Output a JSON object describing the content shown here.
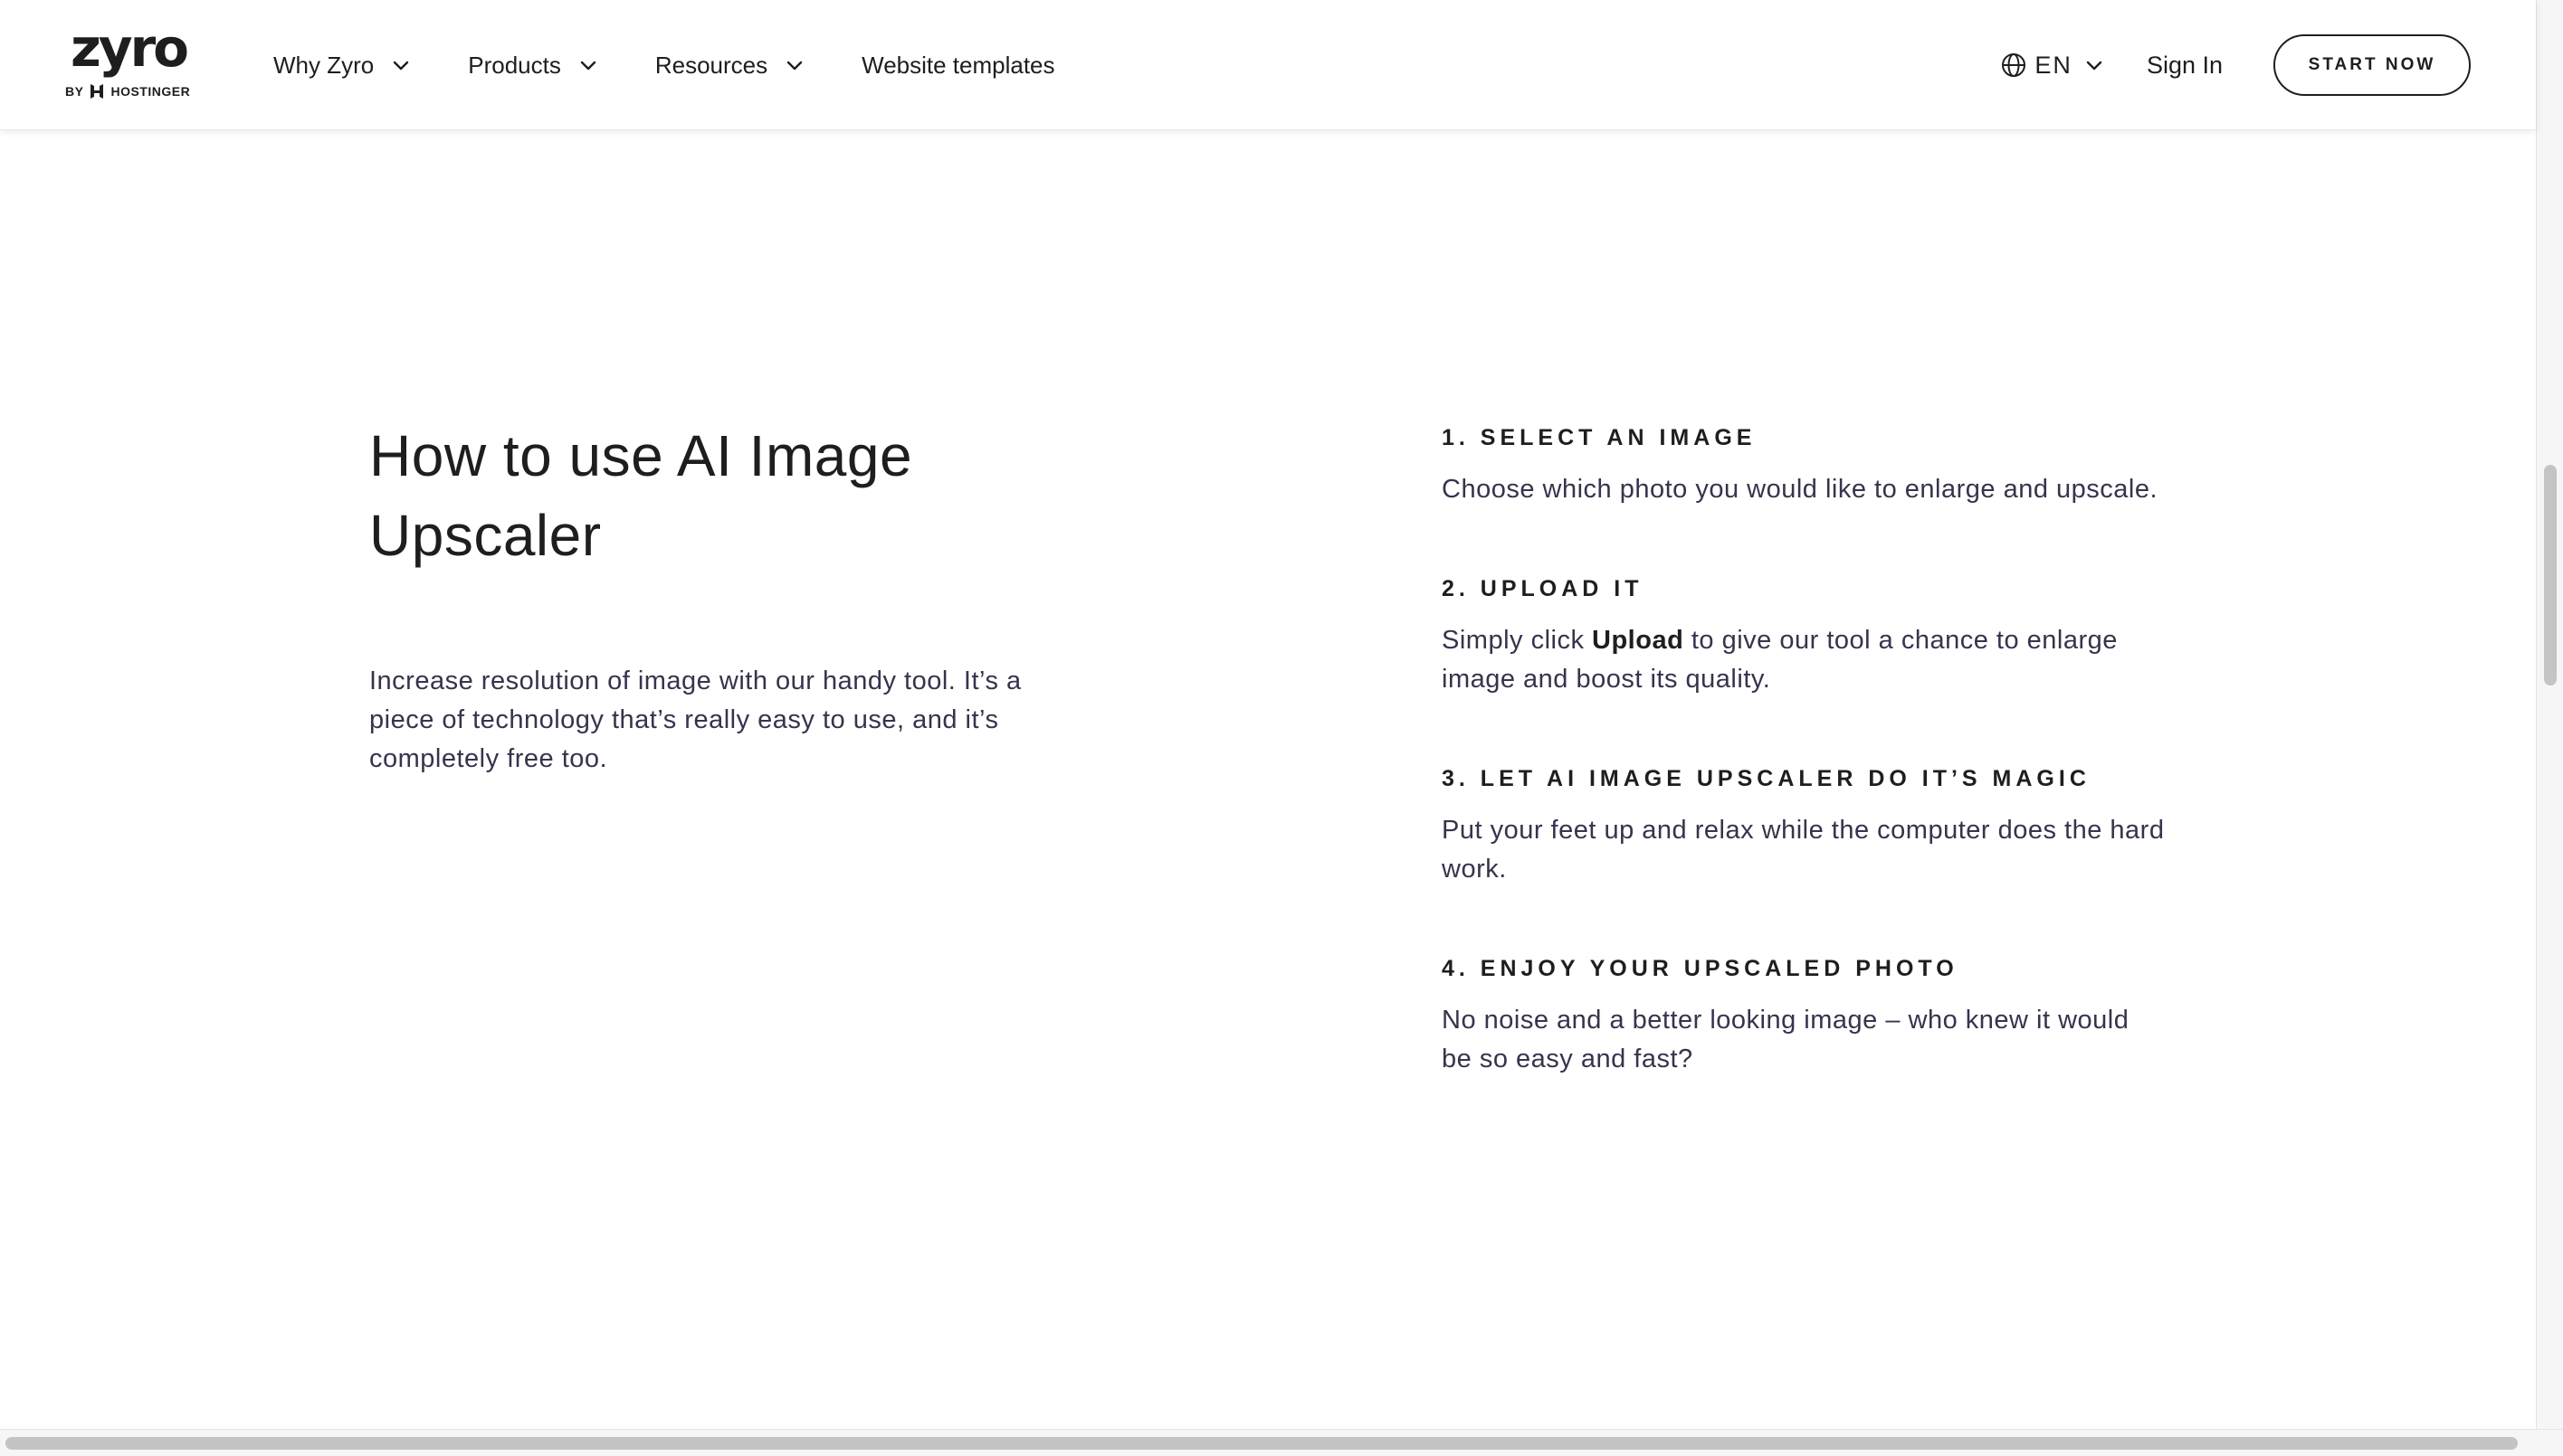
{
  "header": {
    "logo": {
      "word": "zyro",
      "by": "BY",
      "brand": "HOSTINGER"
    },
    "nav": [
      {
        "label": "Why Zyro",
        "has_dropdown": true
      },
      {
        "label": "Products",
        "has_dropdown": true
      },
      {
        "label": "Resources",
        "has_dropdown": true
      },
      {
        "label": "Website templates",
        "has_dropdown": false
      }
    ],
    "language": "EN",
    "sign_in": "Sign In",
    "start_button": "START NOW"
  },
  "content": {
    "title_line1": "How to use AI Image",
    "title_line2": "Upscaler",
    "intro": "Increase resolution of image with our handy tool. It’s a piece of technology that’s really easy to use, and it’s completely free too.",
    "steps": [
      {
        "title": "1. SELECT AN IMAGE",
        "text": "Choose which photo you would like to enlarge and upscale."
      },
      {
        "title": "2. UPLOAD IT",
        "text_before": "Simply click ",
        "text_bold": "Upload",
        "text_after": " to give our tool a chance to enlarge image and boost its quality."
      },
      {
        "title": "3. LET AI IMAGE UPSCALER DO IT’S MAGIC",
        "text": "Put your feet up and relax while the computer does the hard work."
      },
      {
        "title": "4. ENJOY YOUR UPSCALED PHOTO",
        "text": "No noise and a better looking image – who knew it would be so easy and fast?"
      }
    ]
  },
  "icons": {
    "chevron": "chevron-down-icon",
    "globe": "globe-icon",
    "hostinger": "hostinger-logo-icon"
  },
  "colors": {
    "text": "#1d1e20",
    "body_text": "#36344d",
    "background": "#ffffff"
  }
}
